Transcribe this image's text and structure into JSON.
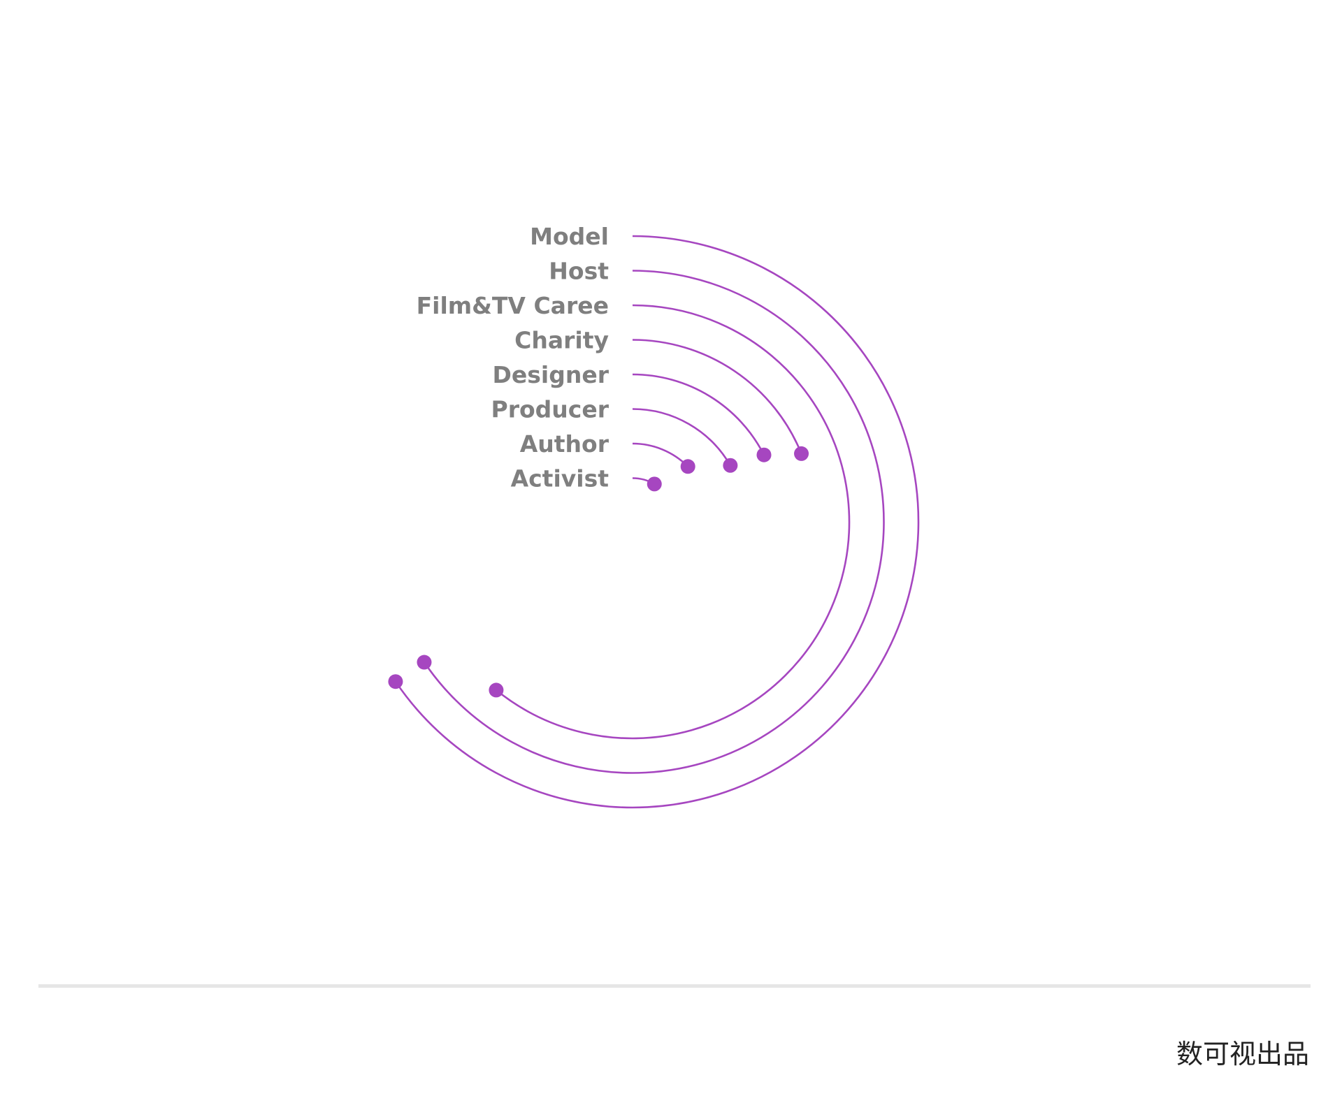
{
  "chart_data": {
    "type": "radial-bar",
    "categories": [
      "Model",
      "Host",
      "Film&TV Caree",
      "Charity",
      "Designer",
      "Producer",
      "Author",
      "Activist"
    ],
    "values": [
      236,
      236,
      219,
      68,
      63,
      60,
      45,
      30
    ],
    "angle_max": 360,
    "start": "top",
    "direction": "clockwise",
    "marker": "dot-at-end"
  },
  "colors": {
    "series": "#a646c0",
    "labels": "#7f7f7f",
    "divider": "#e6e6e6",
    "credit": "#222222"
  },
  "footer": {
    "credit": "数可视出品"
  }
}
